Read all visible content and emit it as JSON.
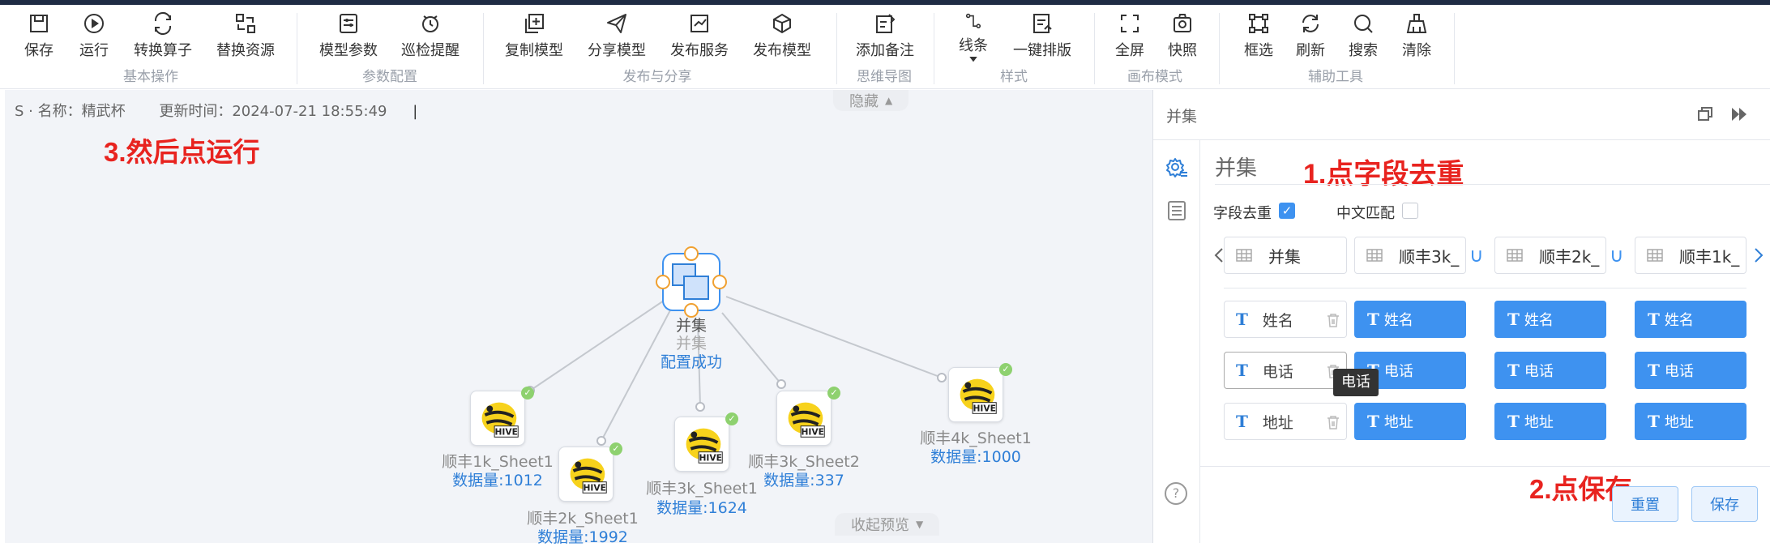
{
  "toolbar": {
    "buttons": [
      {
        "label": "保存",
        "icon": "save-icon"
      },
      {
        "label": "运行",
        "icon": "play-icon"
      },
      {
        "label": "转换算子",
        "icon": "convert-icon"
      },
      {
        "label": "替换资源",
        "icon": "replace-icon"
      },
      {
        "label": "模型参数",
        "icon": "params-icon"
      },
      {
        "label": "巡检提醒",
        "icon": "patrol-icon"
      },
      {
        "label": "复制模型",
        "icon": "copy-icon"
      },
      {
        "label": "分享模型",
        "icon": "share-icon"
      },
      {
        "label": "发布服务",
        "icon": "publish-service-icon"
      },
      {
        "label": "发布模型",
        "icon": "publish-model-icon"
      },
      {
        "label": "添加备注",
        "icon": "note-icon"
      },
      {
        "label": "线条",
        "icon": "line-icon"
      },
      {
        "label": "一键排版",
        "icon": "layout-icon"
      },
      {
        "label": "全屏",
        "icon": "fullscreen-icon"
      },
      {
        "label": "快照",
        "icon": "snapshot-icon"
      },
      {
        "label": "框选",
        "icon": "select-box-icon"
      },
      {
        "label": "刷新",
        "icon": "refresh-icon"
      },
      {
        "label": "搜索",
        "icon": "search-icon"
      },
      {
        "label": "清除",
        "icon": "clear-icon"
      }
    ],
    "groups": [
      "基本操作",
      "参数配置",
      "发布与分享",
      "思维导图",
      "样式",
      "画布模式",
      "辅助工具"
    ]
  },
  "canvas": {
    "name_prefix": "S · 名称：",
    "name": "精武杯",
    "update_label": "更新时间：",
    "update_time": "2024-07-21 18:55:49",
    "hide_tab": "隐藏",
    "collapse_tab": "收起预览",
    "annotation": "3.然后点运行",
    "union_node": {
      "title": "并集",
      "subtitle": "并集",
      "status": "配置成功"
    },
    "nodes": [
      {
        "name": "顺丰1k_Sheet1",
        "count": "数据量:1012"
      },
      {
        "name": "顺丰2k_Sheet1",
        "count": "数据量:1992"
      },
      {
        "name": "顺丰3k_Sheet1",
        "count": "数据量:1624"
      },
      {
        "name": "顺丰3k_Sheet2",
        "count": "数据量:337"
      },
      {
        "name": "顺丰4k_Sheet1",
        "count": "数据量:1000"
      }
    ]
  },
  "panel": {
    "header": "并集",
    "title": "并集",
    "annotation1": "1.点字段去重",
    "annotation2": "2.点保存",
    "dedupe_label": "字段去重",
    "dedupe_checked": true,
    "cn_match_label": "中文匹配",
    "cn_match_checked": false,
    "sources": [
      "并集",
      "顺丰3k_",
      "顺丰2k_",
      "顺丰1k_"
    ],
    "union_symbol": "∪",
    "fields": [
      "姓名",
      "电话",
      "地址"
    ],
    "tooltip": "电话",
    "reset": "重置",
    "save": "保存",
    "help": "?"
  },
  "colors": {
    "accent": "#3e92f0",
    "annotation": "#e8231f",
    "status": "#2f7fd7"
  }
}
